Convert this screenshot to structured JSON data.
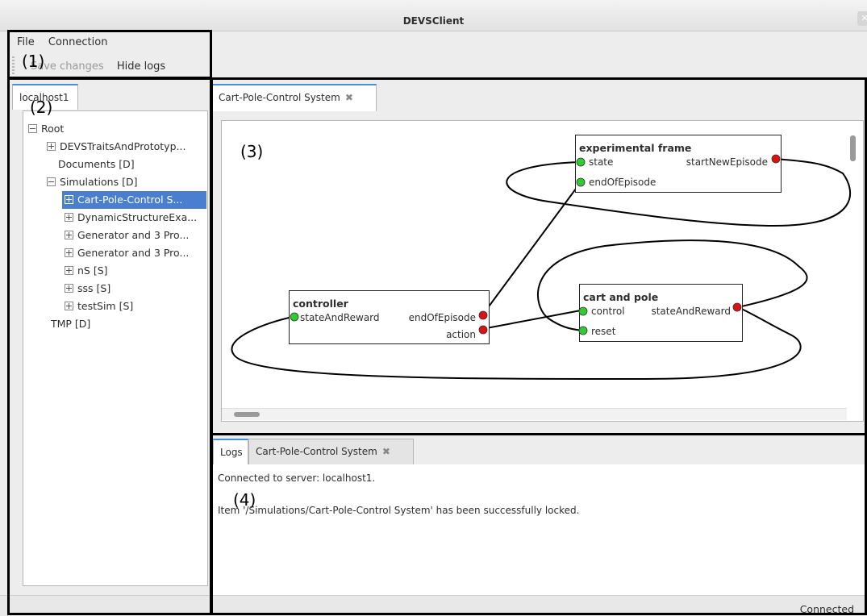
{
  "window": {
    "title": "DEVSClient"
  },
  "menu": {
    "file": "File",
    "connection": "Connection"
  },
  "toolbar": {
    "save_changes": "Save changes",
    "hide_logs": "Hide logs"
  },
  "callouts": {
    "c1": "(1)",
    "c2": "(2)",
    "c3": "(3)",
    "c4": "(4)"
  },
  "server_tab": "localhost1",
  "tree": {
    "root": "Root",
    "items": [
      "DEVSTraitsAndPrototyp...",
      "Documents [D]",
      "Simulations [D]",
      "Cart-Pole-Control S...",
      "DynamicStructureExa...",
      "Generator and 3 Pro...",
      "Generator and 3 Pro...",
      "nS [S]",
      "sss [S]",
      "testSim [S]",
      "TMP [D]"
    ],
    "selected": "Cart-Pole-Control S..."
  },
  "editor": {
    "tab_label": "Cart-Pole-Control System"
  },
  "model": {
    "experimental_frame": {
      "title": "experimental frame",
      "in_state": "state",
      "in_end": "endOfEpisode",
      "out_new": "startNewEpisode"
    },
    "controller": {
      "title": "controller",
      "in_state": "stateAndReward",
      "out_end": "endOfEpisode",
      "out_action": "action"
    },
    "cart_pole": {
      "title": "cart and pole",
      "in_control": "control",
      "in_reset": "reset",
      "out_state": "stateAndReward"
    }
  },
  "colors": {
    "input_port": "#2ecc2e",
    "output_port": "#dd1111",
    "selection": "#4a7fd0",
    "tab_accent": "#4a90d9"
  },
  "logs": {
    "tab_logs": "Logs",
    "tab_sim": "Cart-Pole-Control System",
    "line1": "Connected to server: localhost1.",
    "line2": "Item '/Simulations/Cart-Pole-Control System' has been successfully locked."
  },
  "status": "Connected"
}
